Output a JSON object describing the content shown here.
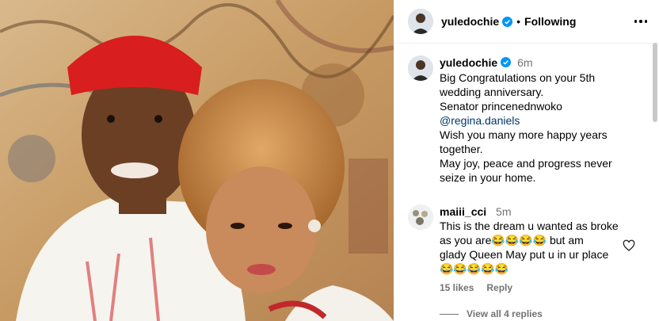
{
  "post": {
    "username": "yuledochie",
    "following_label": "Following",
    "dot": "•"
  },
  "caption": {
    "username": "yuledochie",
    "time": "6m",
    "lines": [
      "Big Congratulations on your 5th",
      "wedding anniversary.",
      "Senator princenednwoko",
      "@regina.daniels",
      "Wish you many more happy years",
      "together.",
      "May joy, peace and progress never",
      "seize in your home."
    ]
  },
  "comment": {
    "username": "maiii_cci",
    "time": "5m",
    "lines": [
      "This is the dream u wanted as broke",
      "as you are😂😂😂😂 but am",
      "glady Queen May put u in ur place",
      "😂😂😂😂😂"
    ],
    "likes": "15 likes",
    "reply": "Reply",
    "view_replies": "View all 4 replies"
  },
  "colors": {
    "verified": "#0095f6",
    "mention": "#00376b",
    "muted": "#737373"
  },
  "icons": {
    "verified": "verified-badge-icon",
    "more": "more-options-icon",
    "heart": "heart-icon"
  }
}
